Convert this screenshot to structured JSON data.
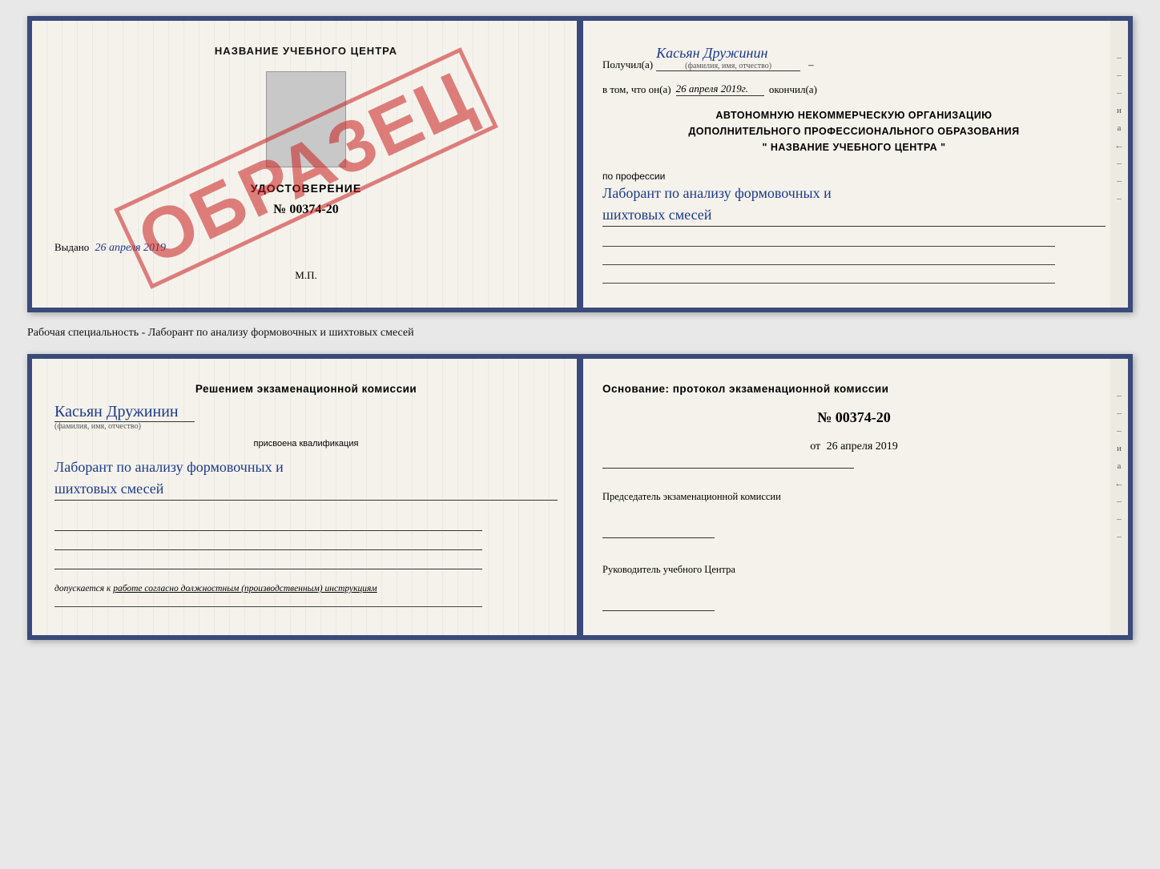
{
  "top_doc": {
    "left": {
      "title": "НАЗВАНИЕ УЧЕБНОГО ЦЕНТРА",
      "cert_label": "УДОСТОВЕРЕНИЕ",
      "cert_number": "№ 00374-20",
      "issued_label": "Выдано",
      "issued_date": "26 апреля 2019",
      "mp_label": "М.П.",
      "stamp_text": "ОБРАЗЕЦ"
    },
    "right": {
      "received_label": "Получил(а)",
      "recipient_name": "Касьян Дружинин",
      "recipient_sublabel": "(фамилия, имя, отчество)",
      "completed_prefix": "в том, что он(а)",
      "completed_date": "26 апреля 2019г.",
      "completed_suffix": "окончил(а)",
      "org_line1": "АВТОНОМНУЮ НЕКОММЕРЧЕСКУЮ ОРГАНИЗАЦИЮ",
      "org_line2": "ДОПОЛНИТЕЛЬНОГО ПРОФЕССИОНАЛЬНОГО ОБРАЗОВАНИЯ",
      "org_line3": "\"  НАЗВАНИЕ УЧЕБНОГО ЦЕНТРА  \"",
      "profession_label": "по профессии",
      "profession_value_line1": "Лаборант по анализу формовочных и",
      "profession_value_line2": "шихтовых смесей",
      "right_chars": [
        "-",
        "-",
        "-",
        "и",
        "а",
        "←",
        "-",
        "-",
        "-"
      ]
    }
  },
  "separator": {
    "text": "Рабочая специальность - Лаборант по анализу формовочных и шихтовых смесей"
  },
  "bottom_doc": {
    "left": {
      "decision_title": "Решением экзаменационной комиссии",
      "name": "Касьян Дружинин",
      "name_sublabel": "(фамилия, имя, отчество)",
      "qualification_label": "присвоена квалификация",
      "qualification_line1": "Лаборант по анализу формовочных и",
      "qualification_line2": "шихтовых смесей",
      "допускается_label": "допускается к",
      "допускается_value": "работе согласно должностным (производственным) инструкциям"
    },
    "right": {
      "basis_label": "Основание: протокол экзаменационной комиссии",
      "protocol_number": "№ 00374-20",
      "date_prefix": "от",
      "date_value": "26 апреля 2019",
      "chairman_label": "Председатель экзаменационной комиссии",
      "director_label": "Руководитель учебного Центра",
      "right_chars": [
        "-",
        "-",
        "-",
        "и",
        "а",
        "←",
        "-",
        "-",
        "-"
      ]
    }
  }
}
